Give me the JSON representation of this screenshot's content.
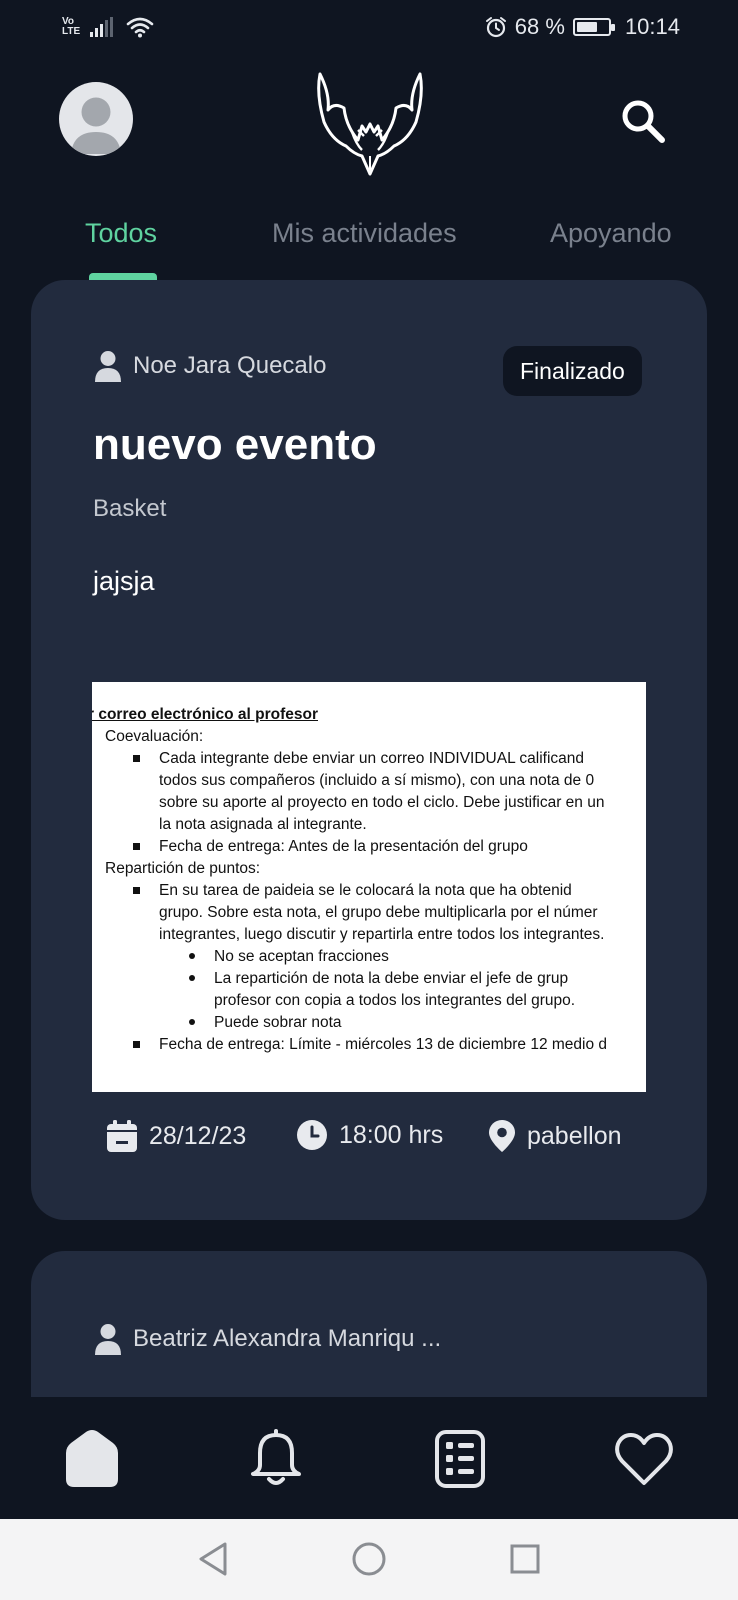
{
  "status_bar": {
    "network_label_top": "Vo",
    "network_label_bottom": "LTE",
    "battery_percent_text": "68 %",
    "battery_level": 0.68,
    "time": "10:14"
  },
  "header": {
    "avatar_icon": "avatar-placeholder-icon",
    "logo_icon": "bat-logo-icon",
    "search_icon": "search-icon"
  },
  "tabs": [
    {
      "label": "Todos",
      "active": true
    },
    {
      "label": "Mis actividades",
      "active": false
    },
    {
      "label": "Apoyando",
      "active": false
    }
  ],
  "cards": [
    {
      "author": "Noe Jara Quecalo",
      "status": "Finalizado",
      "title": "nuevo evento",
      "category": "Basket",
      "description": "jajsja",
      "attachment": {
        "heading": "r correo electrónico al profesor",
        "lines": [
          "Coevaluación:",
          "Cada integrante debe enviar un correo INDIVIDUAL calificand",
          "todos sus compañeros (incluido a sí mismo), con una nota de 0",
          "sobre su aporte al proyecto en todo el ciclo. Debe justificar en un",
          "la nota asignada al integrante.",
          "Fecha de entrega: Antes de la presentación del grupo",
          "Repartición de puntos:",
          "En su tarea de paideia se le colocará la nota que ha obtenid",
          "grupo. Sobre esta nota, el grupo debe multiplicarla por el númer",
          "integrantes, luego discutir y repartirla entre todos los integrantes.",
          "No se aceptan fracciones",
          "La repartición de nota la debe enviar el jefe de grup",
          "profesor con copia a todos los integrantes del grupo.",
          "Puede sobrar nota",
          "Fecha de entrega: Límite - miércoles 13 de diciembre 12 medio d"
        ]
      },
      "date": "28/12/23",
      "time": "18:00 hrs",
      "location": "pabellon"
    },
    {
      "author": "Beatriz Alexandra Manriqu ..."
    }
  ],
  "bottom_nav": [
    {
      "icon": "home-icon",
      "active": true
    },
    {
      "icon": "bell-icon",
      "active": false
    },
    {
      "icon": "list-icon",
      "active": false
    },
    {
      "icon": "heart-icon",
      "active": false
    }
  ],
  "system_nav": [
    "back-icon",
    "home-circle-icon",
    "recents-icon"
  ]
}
